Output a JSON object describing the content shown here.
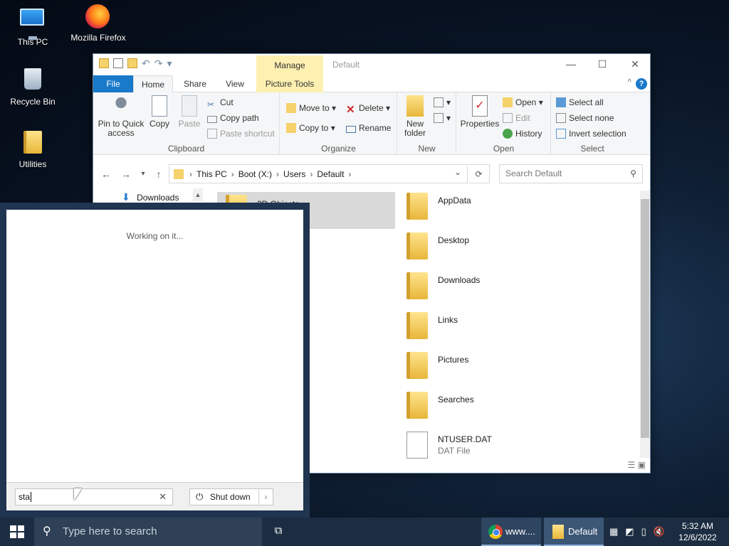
{
  "desktop": {
    "icons": [
      {
        "label": "This PC"
      },
      {
        "label": "Mozilla Firefox"
      },
      {
        "label": "Recycle Bin"
      },
      {
        "label": "Utilities"
      }
    ]
  },
  "explorer": {
    "contextual_tab": "Manage",
    "window_title": "Default",
    "tabs": {
      "file": "File",
      "home": "Home",
      "share": "Share",
      "view": "View",
      "picture_tools": "Picture Tools"
    },
    "ribbon": {
      "clipboard": {
        "label": "Clipboard",
        "pin": "Pin to Quick access",
        "copy": "Copy",
        "paste": "Paste",
        "cut": "Cut",
        "copy_path": "Copy path",
        "paste_shortcut": "Paste shortcut"
      },
      "organize": {
        "label": "Organize",
        "move_to": "Move to",
        "copy_to": "Copy to",
        "delete": "Delete",
        "rename": "Rename"
      },
      "new": {
        "label": "New",
        "new_folder": "New folder"
      },
      "open": {
        "label": "Open",
        "properties": "Properties",
        "open": "Open",
        "edit": "Edit",
        "history": "History"
      },
      "select": {
        "label": "Select",
        "select_all": "Select all",
        "select_none": "Select none",
        "invert": "Invert selection"
      }
    },
    "breadcrumb": [
      "This PC",
      "Boot (X:)",
      "Users",
      "Default"
    ],
    "search_placeholder": "Search Default",
    "nav_pane": {
      "downloads": "Downloads"
    },
    "selected_item": "3D Objects",
    "items": [
      {
        "name": "AppData",
        "type": ""
      },
      {
        "name": "Desktop",
        "type": ""
      },
      {
        "name": "Downloads",
        "type": ""
      },
      {
        "name": "Links",
        "type": ""
      },
      {
        "name": "Pictures",
        "type": ""
      },
      {
        "name": "Searches",
        "type": ""
      },
      {
        "name": "NTUSER.DAT",
        "type": "DAT File"
      }
    ]
  },
  "dialog": {
    "status": "Working on it...",
    "input_value": "sta",
    "shutdown_label": "Shut down"
  },
  "taskbar": {
    "search_placeholder": "Type here to search",
    "apps": [
      {
        "label": "www...."
      },
      {
        "label": "Default"
      }
    ],
    "time": "5:32 AM",
    "date": "12/6/2022"
  },
  "colors": {
    "accent": "#1979ca",
    "manage_tab": "#fdf0b0",
    "taskbar": "#1c2d42"
  }
}
